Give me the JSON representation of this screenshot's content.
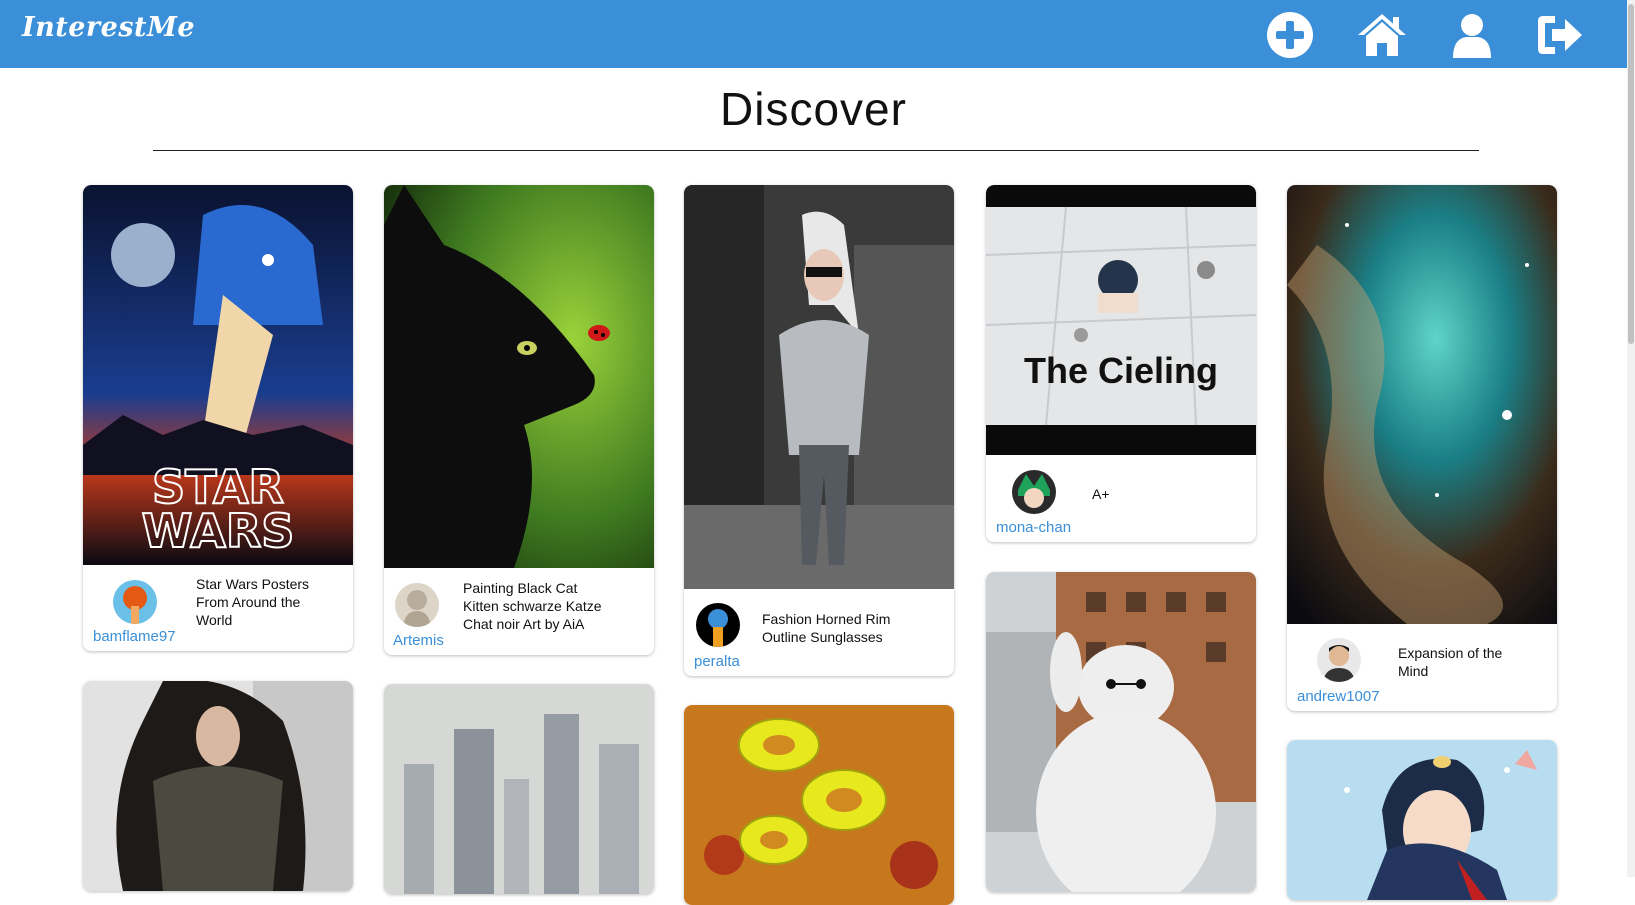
{
  "app": {
    "logo": "InterestMe"
  },
  "nav": {
    "icons": [
      "add-icon",
      "home-icon",
      "profile-icon",
      "logout-icon"
    ],
    "accent_color": "#3a8fd8"
  },
  "page": {
    "title": "Discover"
  },
  "pins": [
    {
      "caption": "Star Wars Posters From Around the World",
      "user": "bamflame97",
      "image": "star-wars-poster"
    },
    {
      "caption": "Painting Black Cat Kitten schwarze Katze Chat noir Art by AiA",
      "user": "Artemis",
      "image": "black-cat-painting"
    },
    {
      "caption": "Fashion Horned Rim Outline Sunglasses",
      "user": "peralta",
      "image": "woman-sunglasses-photo"
    },
    {
      "caption": "A+",
      "user": "mona-chan",
      "image": "the-cieling",
      "image_text": "The Cieling"
    },
    {
      "caption": "Expansion of the Mind",
      "user": "andrew1007",
      "image": "nebula"
    },
    {
      "image": "woman-scarf-photo"
    },
    {
      "image": "city-painting"
    },
    {
      "image": "pepperoni-pizza"
    },
    {
      "image": "baymax-costume"
    },
    {
      "image": "anime-boy"
    }
  ]
}
